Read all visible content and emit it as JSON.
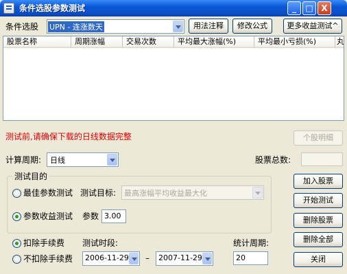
{
  "window": {
    "title": "条件选股参数测试",
    "min_label": "_",
    "max_label": "□",
    "close_label": "X"
  },
  "top": {
    "condition_label": "条件选股",
    "formula_value": "UPN  - 连涨数天",
    "usage_button": "用法注释",
    "modify_button": "修改公式",
    "more_button": "更多收益测试^"
  },
  "table": {
    "columns": [
      "股票名称",
      "周期涨幅",
      "交易次数",
      "平均最大涨幅(%)",
      "平均最小亏损(%)",
      "丸"
    ],
    "rows": []
  },
  "warning": "测试前,请确保下载的日线数据完整",
  "detail_button": "个股明细",
  "period": {
    "label": "计算周期:",
    "value": "日线"
  },
  "total": {
    "label": "股票总数:",
    "value": ""
  },
  "goal": {
    "group_title": "测试目的",
    "best_label": "最佳参数测试",
    "target_label": "测试目标:",
    "target_value": "最高涨幅平均收益最大化",
    "return_label": "参数收益测试",
    "param_label": "参数",
    "param_value": "3.00",
    "selected": "return"
  },
  "fees": {
    "deduct_label": "扣除手续费",
    "no_deduct_label": "不扣除手续费",
    "selected": "deduct"
  },
  "test_period": {
    "label": "测试时段:",
    "start": "2006-11-29",
    "dash": "–",
    "end": "2007-11-29"
  },
  "stat_period": {
    "label": "统计周期:",
    "value": "20"
  },
  "actions": {
    "add": "加入股票",
    "start": "开始测试",
    "delete": "删除股票",
    "delete_all": "删除全部",
    "close": "关闭"
  },
  "colors": {
    "title_bar": "#0a58d8",
    "warning": "#e00000",
    "background": "#ece9d8"
  }
}
